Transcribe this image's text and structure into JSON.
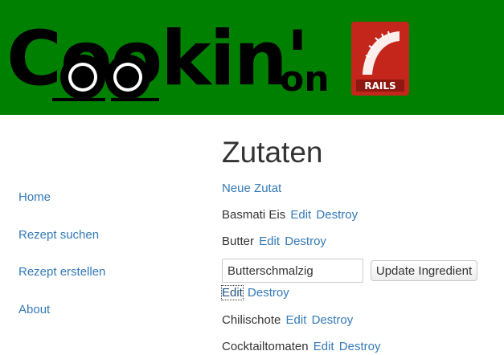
{
  "header": {
    "logo_word": "Cookin'",
    "logo_on": "on",
    "rails_logo_text": "RAILS",
    "colors": {
      "banner": "#008000",
      "rails_red": "#c4261b"
    }
  },
  "sidebar": {
    "items": [
      {
        "label": "Home"
      },
      {
        "label": "Rezept suchen"
      },
      {
        "label": "Rezept erstellen"
      },
      {
        "label": "About"
      }
    ]
  },
  "main": {
    "title": "Zutaten",
    "new_link": "Neue Zutat",
    "ingredients": [
      {
        "name": "Basmati Eis",
        "edit": "Edit",
        "destroy": "Destroy"
      },
      {
        "name": "Butter",
        "edit": "Edit",
        "destroy": "Destroy"
      },
      {
        "name": "",
        "edit": "Edit",
        "destroy": "Destroy"
      },
      {
        "name": "Chilischote",
        "edit": "Edit",
        "destroy": "Destroy"
      },
      {
        "name": "Cocktailtomaten",
        "edit": "Edit",
        "destroy": "Destroy"
      }
    ],
    "edit_form": {
      "value": "Butterschmalzig",
      "submit_label": "Update Ingredient"
    }
  },
  "colors": {
    "link": "#337ab7",
    "text": "#333333"
  }
}
